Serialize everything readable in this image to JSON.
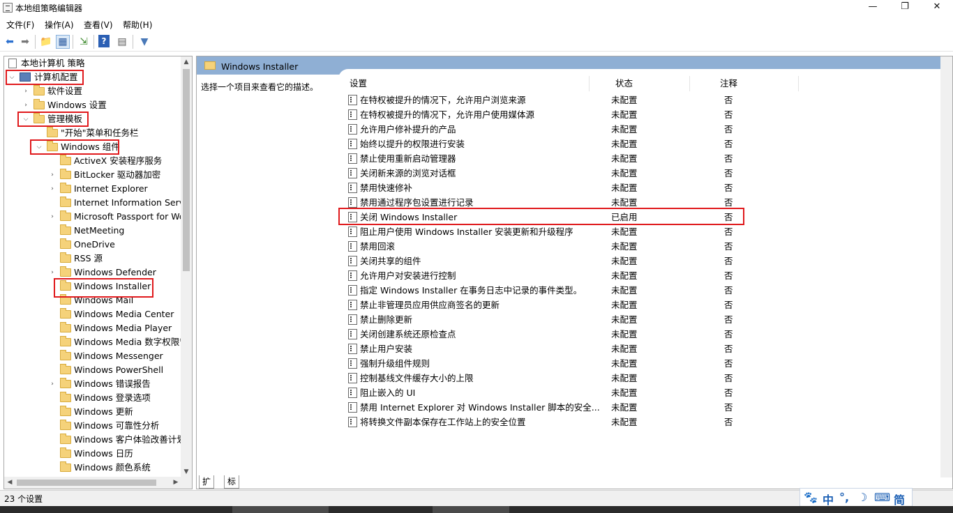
{
  "window": {
    "title": "本地组策略编辑器",
    "min_glyph": "—",
    "max_glyph": "❐",
    "close_glyph": "✕"
  },
  "menu": [
    "文件(F)",
    "操作(A)",
    "查看(V)",
    "帮助(H)"
  ],
  "toolbar": {
    "icons": [
      "back-arrow-icon",
      "forward-arrow-icon",
      "up-folder-icon",
      "show-hide-tree-icon",
      "export-list-icon",
      "help-icon",
      "properties-icon",
      "filter-icon"
    ],
    "glyphs": {
      "back": "⬅",
      "forward": "➡",
      "up": "📁",
      "tree": "▦",
      "export": "⇲",
      "help": "?",
      "props": "▤",
      "filter": "▼"
    }
  },
  "tree": {
    "root": "本地计算机 策略",
    "computer_config": "计算机配置",
    "software_settings": "软件设置",
    "windows_settings": "Windows 设置",
    "admin_templates": "管理模板",
    "start_menu": "\"开始\"菜单和任务栏",
    "windows_components": "Windows 组件",
    "items": [
      "ActiveX 安装程序服务",
      "BitLocker 驱动器加密",
      "Internet Explorer",
      "Internet Information Servic",
      "Microsoft Passport for Wo",
      "NetMeeting",
      "OneDrive",
      "RSS 源",
      "Windows Defender",
      "Windows Installer",
      "Windows Mail",
      "Windows Media Center",
      "Windows Media Player",
      "Windows Media 数字权限管",
      "Windows Messenger",
      "Windows PowerShell",
      "Windows 错误报告",
      "Windows 登录选项",
      "Windows 更新",
      "Windows 可靠性分析",
      "Windows 客户体验改善计划",
      "Windows 日历",
      "Windows 颜色系统"
    ]
  },
  "right": {
    "header": "Windows Installer",
    "description": "选择一个项目来查看它的描述。",
    "columns": {
      "setting": "设置",
      "state": "状态",
      "comment": "注释"
    },
    "rows": [
      {
        "name": "在特权被提升的情况下，允许用户浏览来源",
        "state": "未配置",
        "comment": "否"
      },
      {
        "name": "在特权被提升的情况下，允许用户使用媒体源",
        "state": "未配置",
        "comment": "否"
      },
      {
        "name": "允许用户修补提升的产品",
        "state": "未配置",
        "comment": "否"
      },
      {
        "name": "始终以提升的权限进行安装",
        "state": "未配置",
        "comment": "否"
      },
      {
        "name": "禁止使用重新启动管理器",
        "state": "未配置",
        "comment": "否"
      },
      {
        "name": "关闭新来源的浏览对话框",
        "state": "未配置",
        "comment": "否"
      },
      {
        "name": "禁用快速修补",
        "state": "未配置",
        "comment": "否"
      },
      {
        "name": "禁用通过程序包设置进行记录",
        "state": "未配置",
        "comment": "否"
      },
      {
        "name": "关闭 Windows Installer",
        "state": "已启用",
        "comment": "否"
      },
      {
        "name": "阻止用户使用 Windows Installer 安装更新和升级程序",
        "state": "未配置",
        "comment": "否"
      },
      {
        "name": "禁用回滚",
        "state": "未配置",
        "comment": "否"
      },
      {
        "name": "关闭共享的组件",
        "state": "未配置",
        "comment": "否"
      },
      {
        "name": "允许用户对安装进行控制",
        "state": "未配置",
        "comment": "否"
      },
      {
        "name": "指定 Windows Installer 在事务日志中记录的事件类型。",
        "state": "未配置",
        "comment": "否"
      },
      {
        "name": "禁止非管理员应用供应商签名的更新",
        "state": "未配置",
        "comment": "否"
      },
      {
        "name": "禁止删除更新",
        "state": "未配置",
        "comment": "否"
      },
      {
        "name": "关闭创建系统还原检查点",
        "state": "未配置",
        "comment": "否"
      },
      {
        "name": "禁止用户安装",
        "state": "未配置",
        "comment": "否"
      },
      {
        "name": "强制升级组件规则",
        "state": "未配置",
        "comment": "否"
      },
      {
        "name": "控制基线文件缓存大小的上限",
        "state": "未配置",
        "comment": "否"
      },
      {
        "name": "阻止嵌入的 UI",
        "state": "未配置",
        "comment": "否"
      },
      {
        "name": "禁用 Internet Explorer 对 Windows Installer 脚本的安全...",
        "state": "未配置",
        "comment": "否"
      },
      {
        "name": "将转换文件副本保存在工作站上的安全位置",
        "state": "未配置",
        "comment": "否"
      }
    ]
  },
  "tabs": [
    "扩展",
    "标准"
  ],
  "status": "23 个设置",
  "ime": [
    "🐾",
    "中",
    "°,",
    "☽",
    "⌨",
    "简"
  ],
  "highlight_color": "#e0191c",
  "header_color": "#8fafd4"
}
